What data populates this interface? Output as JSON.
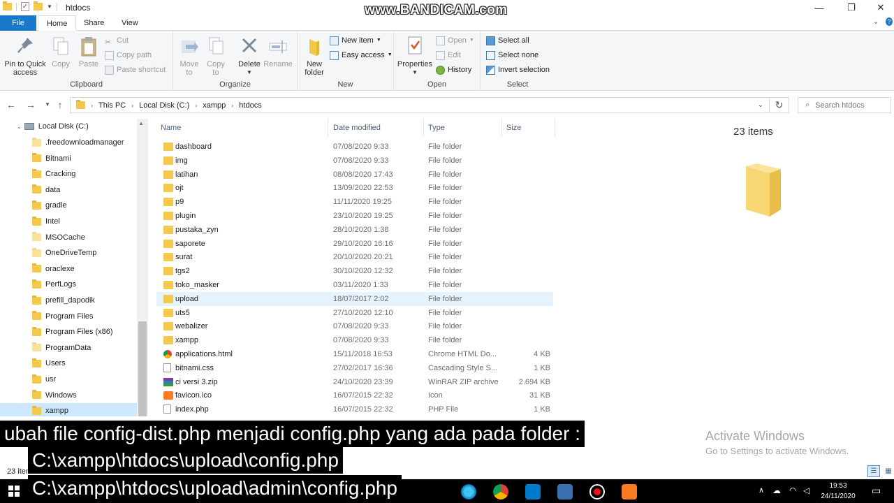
{
  "window": {
    "title": "htdocs",
    "watermark": "www.BANDICAM.com"
  },
  "ribbon_tabs": [
    "File",
    "Home",
    "Share",
    "View"
  ],
  "ribbon": {
    "clipboard": {
      "label": "Clipboard",
      "pin": "Pin to Quick access",
      "copy": "Copy",
      "paste": "Paste",
      "cut": "Cut",
      "copy_path": "Copy path",
      "paste_shortcut": "Paste shortcut"
    },
    "organize": {
      "label": "Organize",
      "move_to": "Move to",
      "copy_to": "Copy to",
      "delete": "Delete",
      "rename": "Rename"
    },
    "new": {
      "label": "New",
      "new_folder": "New folder",
      "new_item": "New item",
      "easy_access": "Easy access"
    },
    "open": {
      "label": "Open",
      "properties": "Properties",
      "open": "Open",
      "edit": "Edit",
      "history": "History"
    },
    "select": {
      "label": "Select",
      "select_all": "Select all",
      "select_none": "Select none",
      "invert": "Invert selection"
    }
  },
  "address": {
    "crumbs": [
      "This PC",
      "Local Disk (C:)",
      "xampp",
      "htdocs"
    ],
    "search_placeholder": "Search htdocs"
  },
  "nav_pane": {
    "root": "Local Disk (C:)",
    "items": [
      ".freedownloadmanager",
      "Bitnami",
      "Cracking",
      "data",
      "gradle",
      "Intel",
      "MSOCache",
      "OneDriveTemp",
      "oraclexe",
      "PerfLogs",
      "prefill_dapodik",
      "Program Files",
      "Program Files (x86)",
      "ProgramData",
      "Users",
      "usr",
      "Windows",
      "xampp"
    ]
  },
  "columns": {
    "name": "Name",
    "date": "Date modified",
    "type": "Type",
    "size": "Size"
  },
  "files": [
    {
      "name": "dashboard",
      "date": "07/08/2020 9:33",
      "type": "File folder",
      "size": "",
      "icon": "folder-icon"
    },
    {
      "name": "img",
      "date": "07/08/2020 9:33",
      "type": "File folder",
      "size": "",
      "icon": "folder-icon"
    },
    {
      "name": "latihan",
      "date": "08/08/2020 17:43",
      "type": "File folder",
      "size": "",
      "icon": "folder-icon"
    },
    {
      "name": "ojt",
      "date": "13/09/2020 22:53",
      "type": "File folder",
      "size": "",
      "icon": "folder-icon"
    },
    {
      "name": "p9",
      "date": "11/11/2020 19:25",
      "type": "File folder",
      "size": "",
      "icon": "folder-icon"
    },
    {
      "name": "plugin",
      "date": "23/10/2020 19:25",
      "type": "File folder",
      "size": "",
      "icon": "folder-icon"
    },
    {
      "name": "pustaka_zyn",
      "date": "28/10/2020 1:38",
      "type": "File folder",
      "size": "",
      "icon": "folder-icon"
    },
    {
      "name": "saporete",
      "date": "29/10/2020 16:16",
      "type": "File folder",
      "size": "",
      "icon": "folder-icon"
    },
    {
      "name": "surat",
      "date": "20/10/2020 20:21",
      "type": "File folder",
      "size": "",
      "icon": "folder-icon"
    },
    {
      "name": "tgs2",
      "date": "30/10/2020 12:32",
      "type": "File folder",
      "size": "",
      "icon": "folder-icon"
    },
    {
      "name": "toko_masker",
      "date": "03/11/2020 1:33",
      "type": "File folder",
      "size": "",
      "icon": "folder-icon"
    },
    {
      "name": "upload",
      "date": "18/07/2017 2:02",
      "type": "File folder",
      "size": "",
      "icon": "folder-icon"
    },
    {
      "name": "uts5",
      "date": "27/10/2020 12:10",
      "type": "File folder",
      "size": "",
      "icon": "folder-icon"
    },
    {
      "name": "webalizer",
      "date": "07/08/2020 9:33",
      "type": "File folder",
      "size": "",
      "icon": "folder-icon"
    },
    {
      "name": "xampp",
      "date": "07/08/2020 9:33",
      "type": "File folder",
      "size": "",
      "icon": "folder-icon"
    },
    {
      "name": "applications.html",
      "date": "15/11/2018 16:53",
      "type": "Chrome HTML Do...",
      "size": "4 KB",
      "icon": "chrome-icon"
    },
    {
      "name": "bitnami.css",
      "date": "27/02/2017 16:36",
      "type": "Cascading Style S...",
      "size": "1 KB",
      "icon": "css-file-icon"
    },
    {
      "name": "ci versi 3.zip",
      "date": "24/10/2020 23:39",
      "type": "WinRAR ZIP archive",
      "size": "2.694 KB",
      "icon": "winrar-icon"
    },
    {
      "name": "favicon.ico",
      "date": "16/07/2015 22:32",
      "type": "Icon",
      "size": "31 KB",
      "icon": "xampp-icon"
    },
    {
      "name": "index.php",
      "date": "16/07/2015 22:32",
      "type": "PHP File",
      "size": "1 KB",
      "icon": "php-file-icon"
    }
  ],
  "preview": {
    "count": "23 items"
  },
  "status": {
    "text": "23 items"
  },
  "activation": {
    "title": "Activate Windows",
    "subtitle": "Go to Settings to activate Windows."
  },
  "subtitles": [
    "ubah file config-dist.php menjadi config.php yang ada pada folder :",
    "C:\\xampp\\htdocs\\upload\\config.php",
    "C:\\xampp\\htdocs\\upload\\admin\\config.php"
  ],
  "taskbar": {
    "time": "19:53",
    "date": "24/11/2020"
  },
  "colors": {
    "accent": "#1979ca",
    "folder": "#f2c94c",
    "hover_row": "#e5f3ff",
    "selected_nav": "#cce8ff"
  }
}
